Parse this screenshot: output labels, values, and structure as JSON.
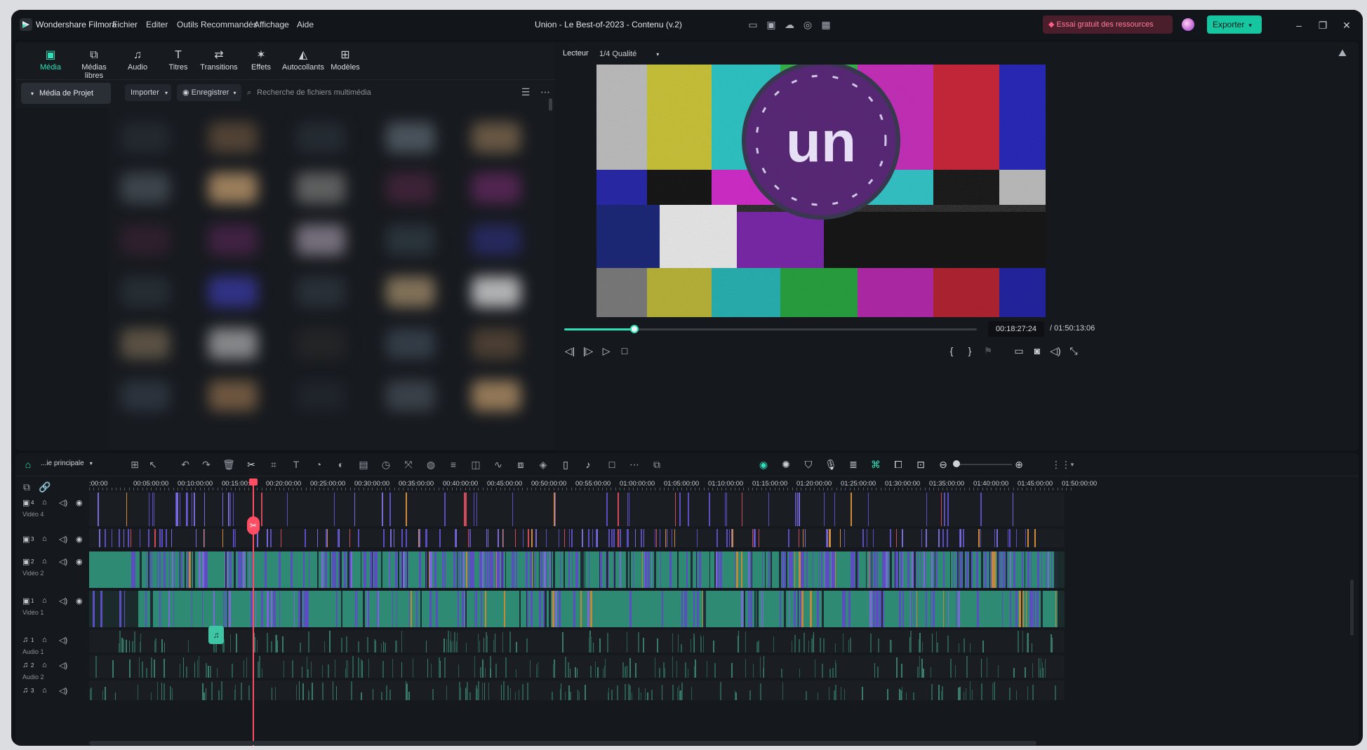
{
  "app": {
    "name": "Wondershare Filmora",
    "menu": [
      "Fichier",
      "Editer",
      "Outils Recommandés",
      "Affichage",
      "Aide"
    ],
    "project_title": "Union - Le Best-of-2023 - Contenu (v.2)",
    "promo_label": "Essai gratuit des ressources",
    "export_label": "Exporter",
    "accent": "#2ee0b8"
  },
  "media_tabs": [
    {
      "label": "Média",
      "icon": "media-icon",
      "active": true
    },
    {
      "label": "Médias libres",
      "icon": "stock-media-icon"
    },
    {
      "label": "Audio",
      "icon": "music-note-icon"
    },
    {
      "label": "Titres",
      "icon": "title-t-icon"
    },
    {
      "label": "Transitions",
      "icon": "transition-icon"
    },
    {
      "label": "Effets",
      "icon": "effects-icon"
    },
    {
      "label": "Autocollants",
      "icon": "sticker-icon"
    },
    {
      "label": "Modèles",
      "icon": "template-icon"
    }
  ],
  "media_toolbar": {
    "project_media": "Média de Projet",
    "import_label": "Importer",
    "record_label": "Enregistrer",
    "search_placeholder": "Recherche de fichiers multimédia"
  },
  "player": {
    "label": "Lecteur",
    "quality": "1/4 Qualité",
    "current_time": "00:18:27:24",
    "total_time": "/ 01:50:13:06",
    "progress": 0.17
  },
  "timeline": {
    "sequence_label": "...ie principale",
    "ruler_ticks": [
      ":00:00",
      "00:05:00:00",
      "00:10:00:00",
      "00:15:00:00",
      "00:20:00:00",
      "00:25:00:00",
      "00:30:00:00",
      "00:35:00:00",
      "00:40:00:00",
      "00:45:00:00",
      "00:50:00:00",
      "00:55:00:00",
      "01:00:00:00",
      "01:05:00:00",
      "01:10:00:00",
      "01:15:00:00",
      "01:20:00:00",
      "01:25:00:00",
      "01:30:00:00",
      "01:35:00:00",
      "01:40:00:00",
      "01:45:00:00",
      "01:50:00:00"
    ],
    "tracks": [
      {
        "id": "4",
        "label": "Vidéo 4",
        "type": "video"
      },
      {
        "id": "3",
        "label": "",
        "type": "video"
      },
      {
        "id": "2",
        "label": "Vidéo 2",
        "type": "video"
      },
      {
        "id": "1",
        "label": "Vidéo 1",
        "type": "video"
      },
      {
        "id": "1",
        "label": "Audio 1",
        "type": "audio"
      },
      {
        "id": "2",
        "label": "Audio 2",
        "type": "audio"
      },
      {
        "id": "3",
        "label": "",
        "type": "audio"
      }
    ]
  }
}
